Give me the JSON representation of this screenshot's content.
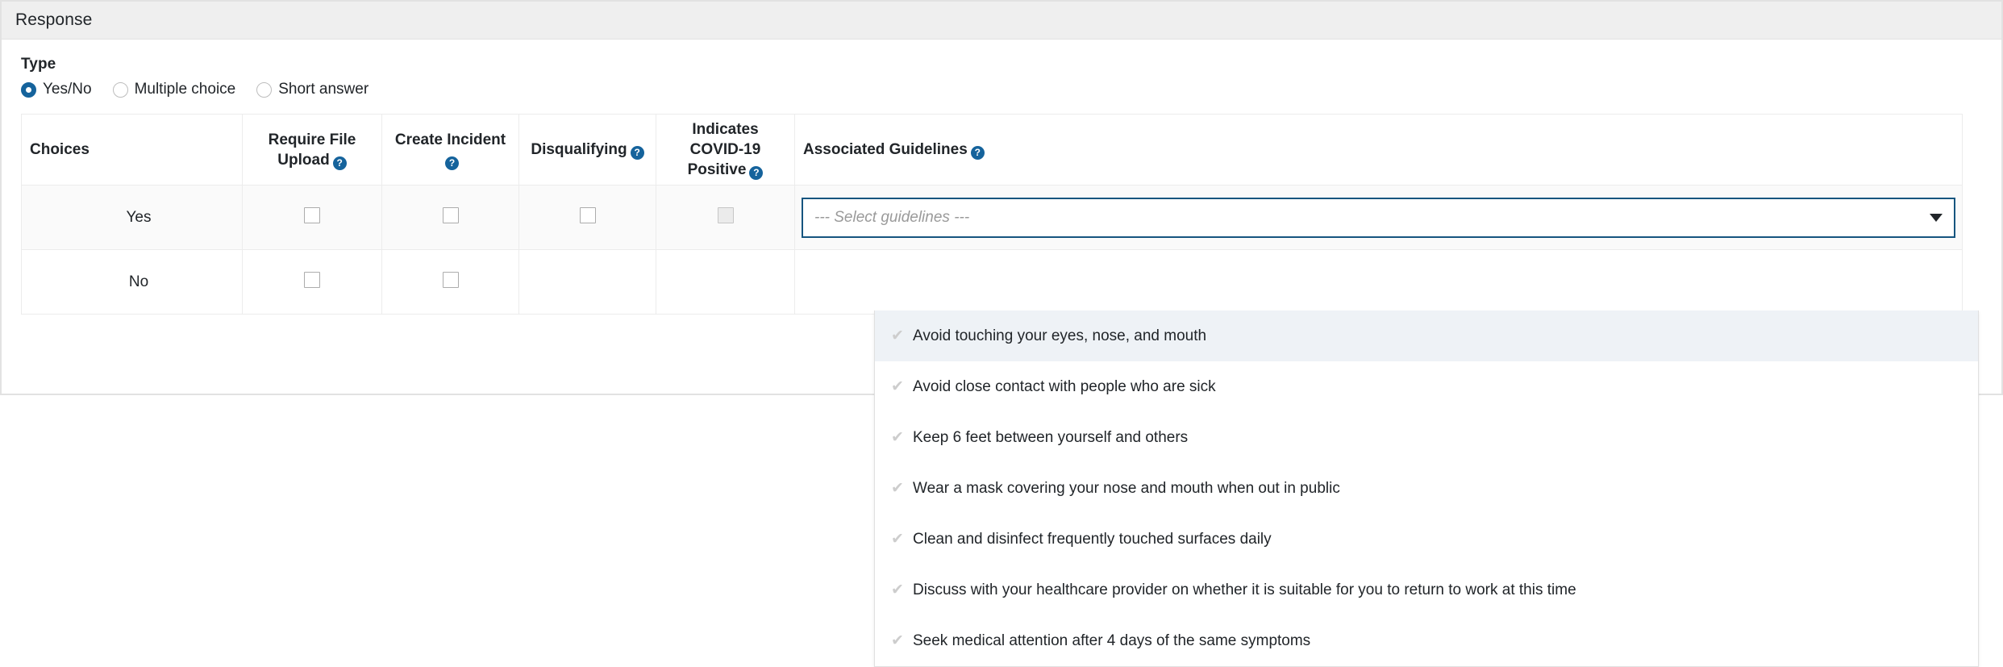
{
  "panel": {
    "header_title": "Response"
  },
  "type_section": {
    "label": "Type",
    "options": [
      {
        "label": "Yes/No",
        "checked": true
      },
      {
        "label": "Multiple choice",
        "checked": false
      },
      {
        "label": "Short answer",
        "checked": false
      }
    ]
  },
  "table": {
    "headers": {
      "choices": "Choices",
      "require_file_upload": "Require File Upload",
      "create_incident": "Create Incident",
      "disqualifying": "Disqualifying",
      "indicates_covid_positive": "Indicates COVID-19 Positive",
      "associated_guidelines": "Associated Guidelines"
    },
    "help_icon": "?",
    "rows": [
      {
        "choice": "Yes",
        "striped": true
      },
      {
        "choice": "No",
        "striped": false
      }
    ]
  },
  "select": {
    "placeholder": "--- Select guidelines ---",
    "caret_icon": "chevron-down-icon",
    "expanded": true
  },
  "dropdown": {
    "check_glyph": "✔",
    "options": [
      {
        "label": "Avoid touching your eyes, nose, and mouth",
        "highlighted": true
      },
      {
        "label": "Avoid close contact with people who are sick",
        "highlighted": false
      },
      {
        "label": "Keep 6 feet between yourself and others",
        "highlighted": false
      },
      {
        "label": "Wear a mask covering your nose and mouth when out in public",
        "highlighted": false
      },
      {
        "label": "Clean and disinfect frequently touched surfaces daily",
        "highlighted": false
      },
      {
        "label": "Discuss with your healthcare provider on whether it is suitable for you to return to work at this time",
        "highlighted": false
      },
      {
        "label": "Seek medical attention after 4 days of the same symptoms",
        "highlighted": false
      }
    ]
  },
  "colors": {
    "accent": "#15639c",
    "focus_border": "#16557f",
    "header_bg": "#efefef",
    "row_stripe": "#fafafa",
    "dropdown_highlight": "#eef2f6"
  }
}
